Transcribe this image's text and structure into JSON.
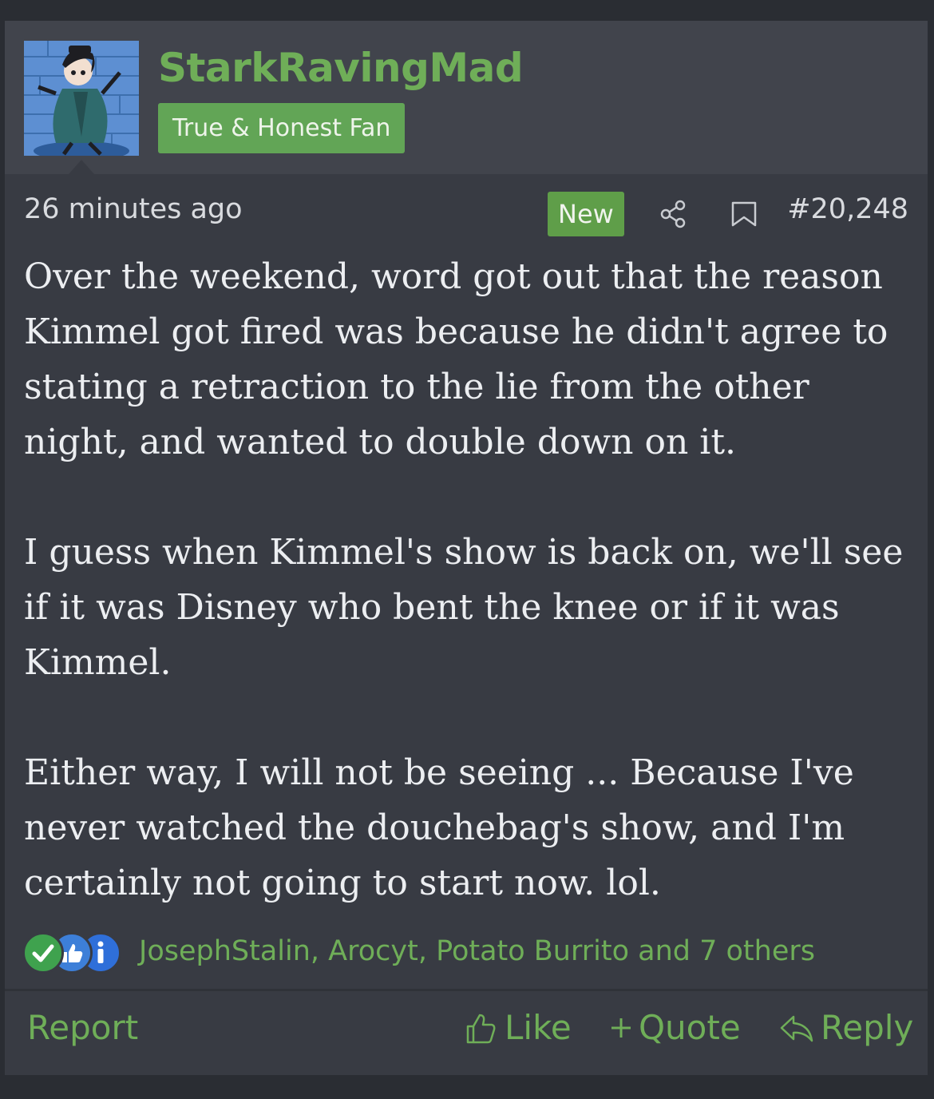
{
  "user": {
    "username": "StarkRavingMad",
    "title": "True & Honest Fan",
    "avatar_icon": "cartoon-avatar"
  },
  "meta": {
    "timestamp": "26 minutes ago",
    "new_badge": "New",
    "post_number": "#20,248"
  },
  "body": {
    "paragraphs": [
      "Over the weekend, word got out that the reason Kimmel got fired was because he didn't agree to stating a retraction to the lie from the other night, and wanted to double down on it.",
      "I guess when Kimmel's show is back on, we'll see if it was Disney who bent the knee or if it was Kimmel.",
      "Either way, I will not be seeing ... Because I've never watched the douchebag's show, and I'm certainly not going to start now. lol."
    ]
  },
  "reactions": {
    "icons": [
      "check-reaction-icon",
      "like-reaction-icon",
      "info-reaction-icon"
    ],
    "text": "JosephStalin, Arocyt, Potato Burrito and 7 others"
  },
  "actions": {
    "report": "Report",
    "like": "Like",
    "quote": "Quote",
    "reply": "Reply"
  },
  "colors": {
    "accent_green": "#6fae58",
    "badge_green": "#62a556",
    "post_bg": "#383b43",
    "header_bg": "#41444c"
  }
}
